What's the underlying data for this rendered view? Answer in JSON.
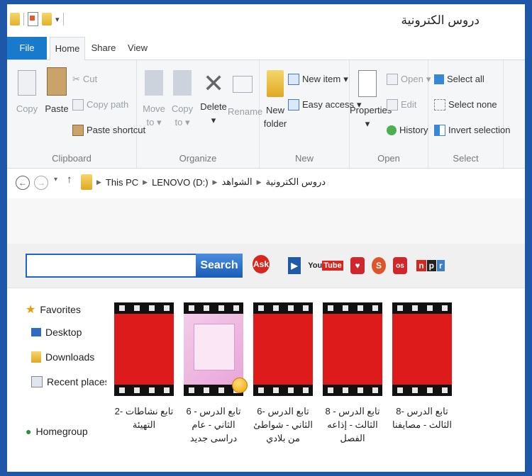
{
  "window": {
    "title": "دروس الكترونية"
  },
  "tabs": {
    "file": "File",
    "home": "Home",
    "share": "Share",
    "view": "View"
  },
  "ribbon": {
    "clipboard": {
      "copy": "Copy",
      "paste": "Paste",
      "cut": "Cut",
      "copy_path": "Copy path",
      "paste_shortcut": "Paste shortcut",
      "label": "Clipboard"
    },
    "organize": {
      "move_to_1": "Move",
      "move_to_2": "to",
      "copy_to_1": "Copy",
      "copy_to_2": "to",
      "delete": "Delete",
      "rename": "Rename",
      "label": "Organize"
    },
    "new": {
      "new_folder_1": "New",
      "new_folder_2": "folder",
      "new_item": "New item",
      "easy_access": "Easy access",
      "label": "New"
    },
    "open": {
      "properties": "Properties",
      "open": "Open",
      "edit": "Edit",
      "history": "History",
      "label": "Open"
    },
    "select": {
      "select_all": "Select all",
      "select_none": "Select none",
      "invert_selection": "Invert selection",
      "label": "Select"
    }
  },
  "address": {
    "crumbs": [
      "This PC",
      "LENOVO (D:)",
      "الشواهد",
      "دروس الكترونية"
    ]
  },
  "toolbar": {
    "search_placeholder": "",
    "search_label": "Search",
    "logos": [
      "Ask",
      "YouTube",
      "npr"
    ]
  },
  "nav": {
    "favorites": "Favorites",
    "desktop": "Desktop",
    "downloads": "Downloads",
    "recent": "Recent places",
    "homegroup": "Homegroup"
  },
  "files": [
    {
      "name": "تابع نشاطات -2 التهيئة"
    },
    {
      "name": "تابع الدرس - 6 الثاني - عام دراسى جديد"
    },
    {
      "name": "تابع الدرس -6 الثاني - شواطئ من بلادي"
    },
    {
      "name": "تابع الدرس - 8 الثالث - إذاعه الفصل"
    },
    {
      "name": "تابع الدرس -8 الثالث - مصايفنا"
    }
  ],
  "colors": {
    "accent": "#1979ca",
    "video_red": "#de1b1b",
    "search_blue": "#1a5bb8"
  }
}
